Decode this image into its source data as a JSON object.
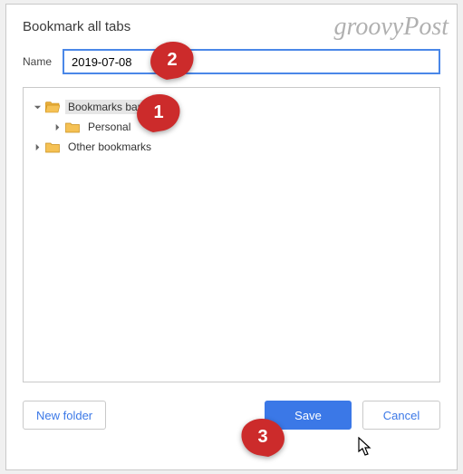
{
  "watermark": "groovyPost",
  "dialog": {
    "title": "Bookmark all tabs",
    "name_label": "Name",
    "name_value": "2019-07-08"
  },
  "tree": {
    "items": [
      {
        "label": "Bookmarks bar",
        "expanded": true,
        "selected": true,
        "open_folder": true,
        "indent": 0
      },
      {
        "label": "Personal",
        "expanded": false,
        "selected": false,
        "open_folder": false,
        "indent": 1,
        "has_children": true
      },
      {
        "label": "Other bookmarks",
        "expanded": false,
        "selected": false,
        "open_folder": false,
        "indent": 0,
        "has_children": true
      }
    ]
  },
  "buttons": {
    "new_folder": "New folder",
    "save": "Save",
    "cancel": "Cancel"
  },
  "annotations": {
    "a1": "1",
    "a2": "2",
    "a3": "3"
  }
}
